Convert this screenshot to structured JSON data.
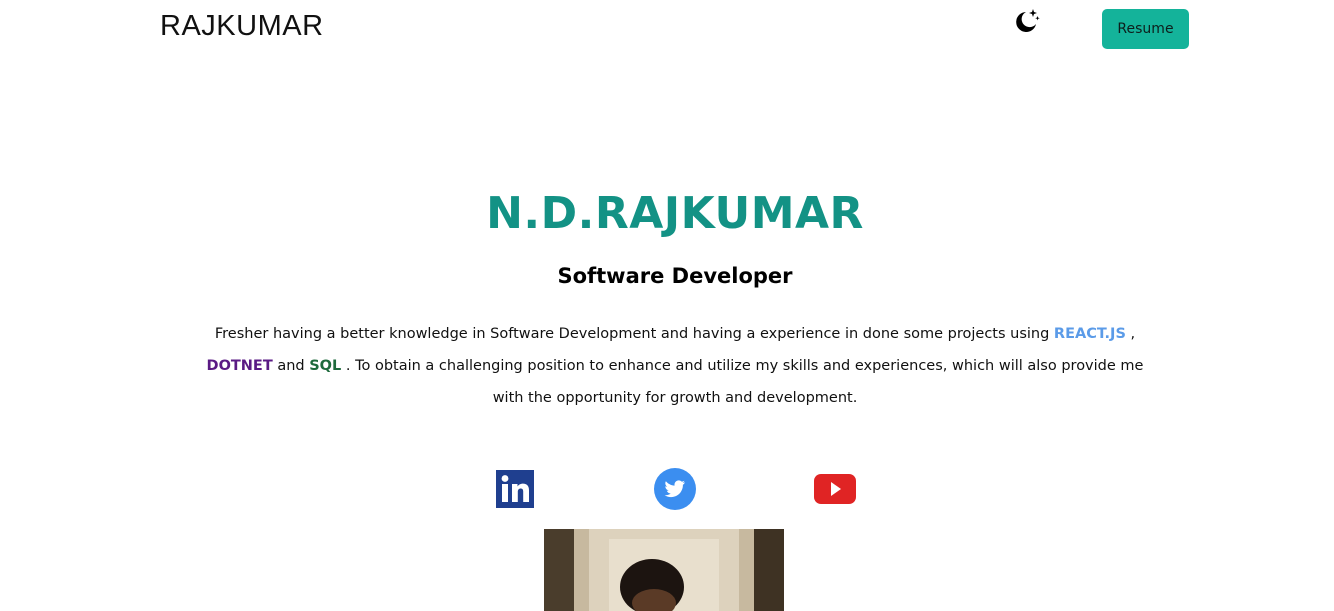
{
  "nav": {
    "brand": "RAJKUMAR",
    "theme_icon": "moon-stars-icon",
    "resume_label": "Resume"
  },
  "hero": {
    "name": "N.D.RAJKUMAR",
    "role": "Software Developer",
    "bio": {
      "part1": "Fresher having a better knowledge in Software Development and having a experience in done some projects using ",
      "react": "REACT.JS",
      "part2": " , ",
      "dotnet": "DOTNET",
      "part3": " and ",
      "sql": "SQL",
      "part4": " . To obtain a challenging position to enhance and utilize my skills and experiences, which will also provide me with the opportunity for growth and development."
    }
  },
  "social": [
    {
      "icon": "linkedin-icon",
      "color": "#1f3f8f"
    },
    {
      "icon": "twitter-icon",
      "color": "#3b8ef0"
    },
    {
      "icon": "youtube-icon",
      "color": "#e02424"
    }
  ],
  "colors": {
    "accent": "#14b39a",
    "title": "#139285",
    "react": "#5b9be8",
    "dotnet": "#5a1a84",
    "sql": "#1e6a3c"
  }
}
